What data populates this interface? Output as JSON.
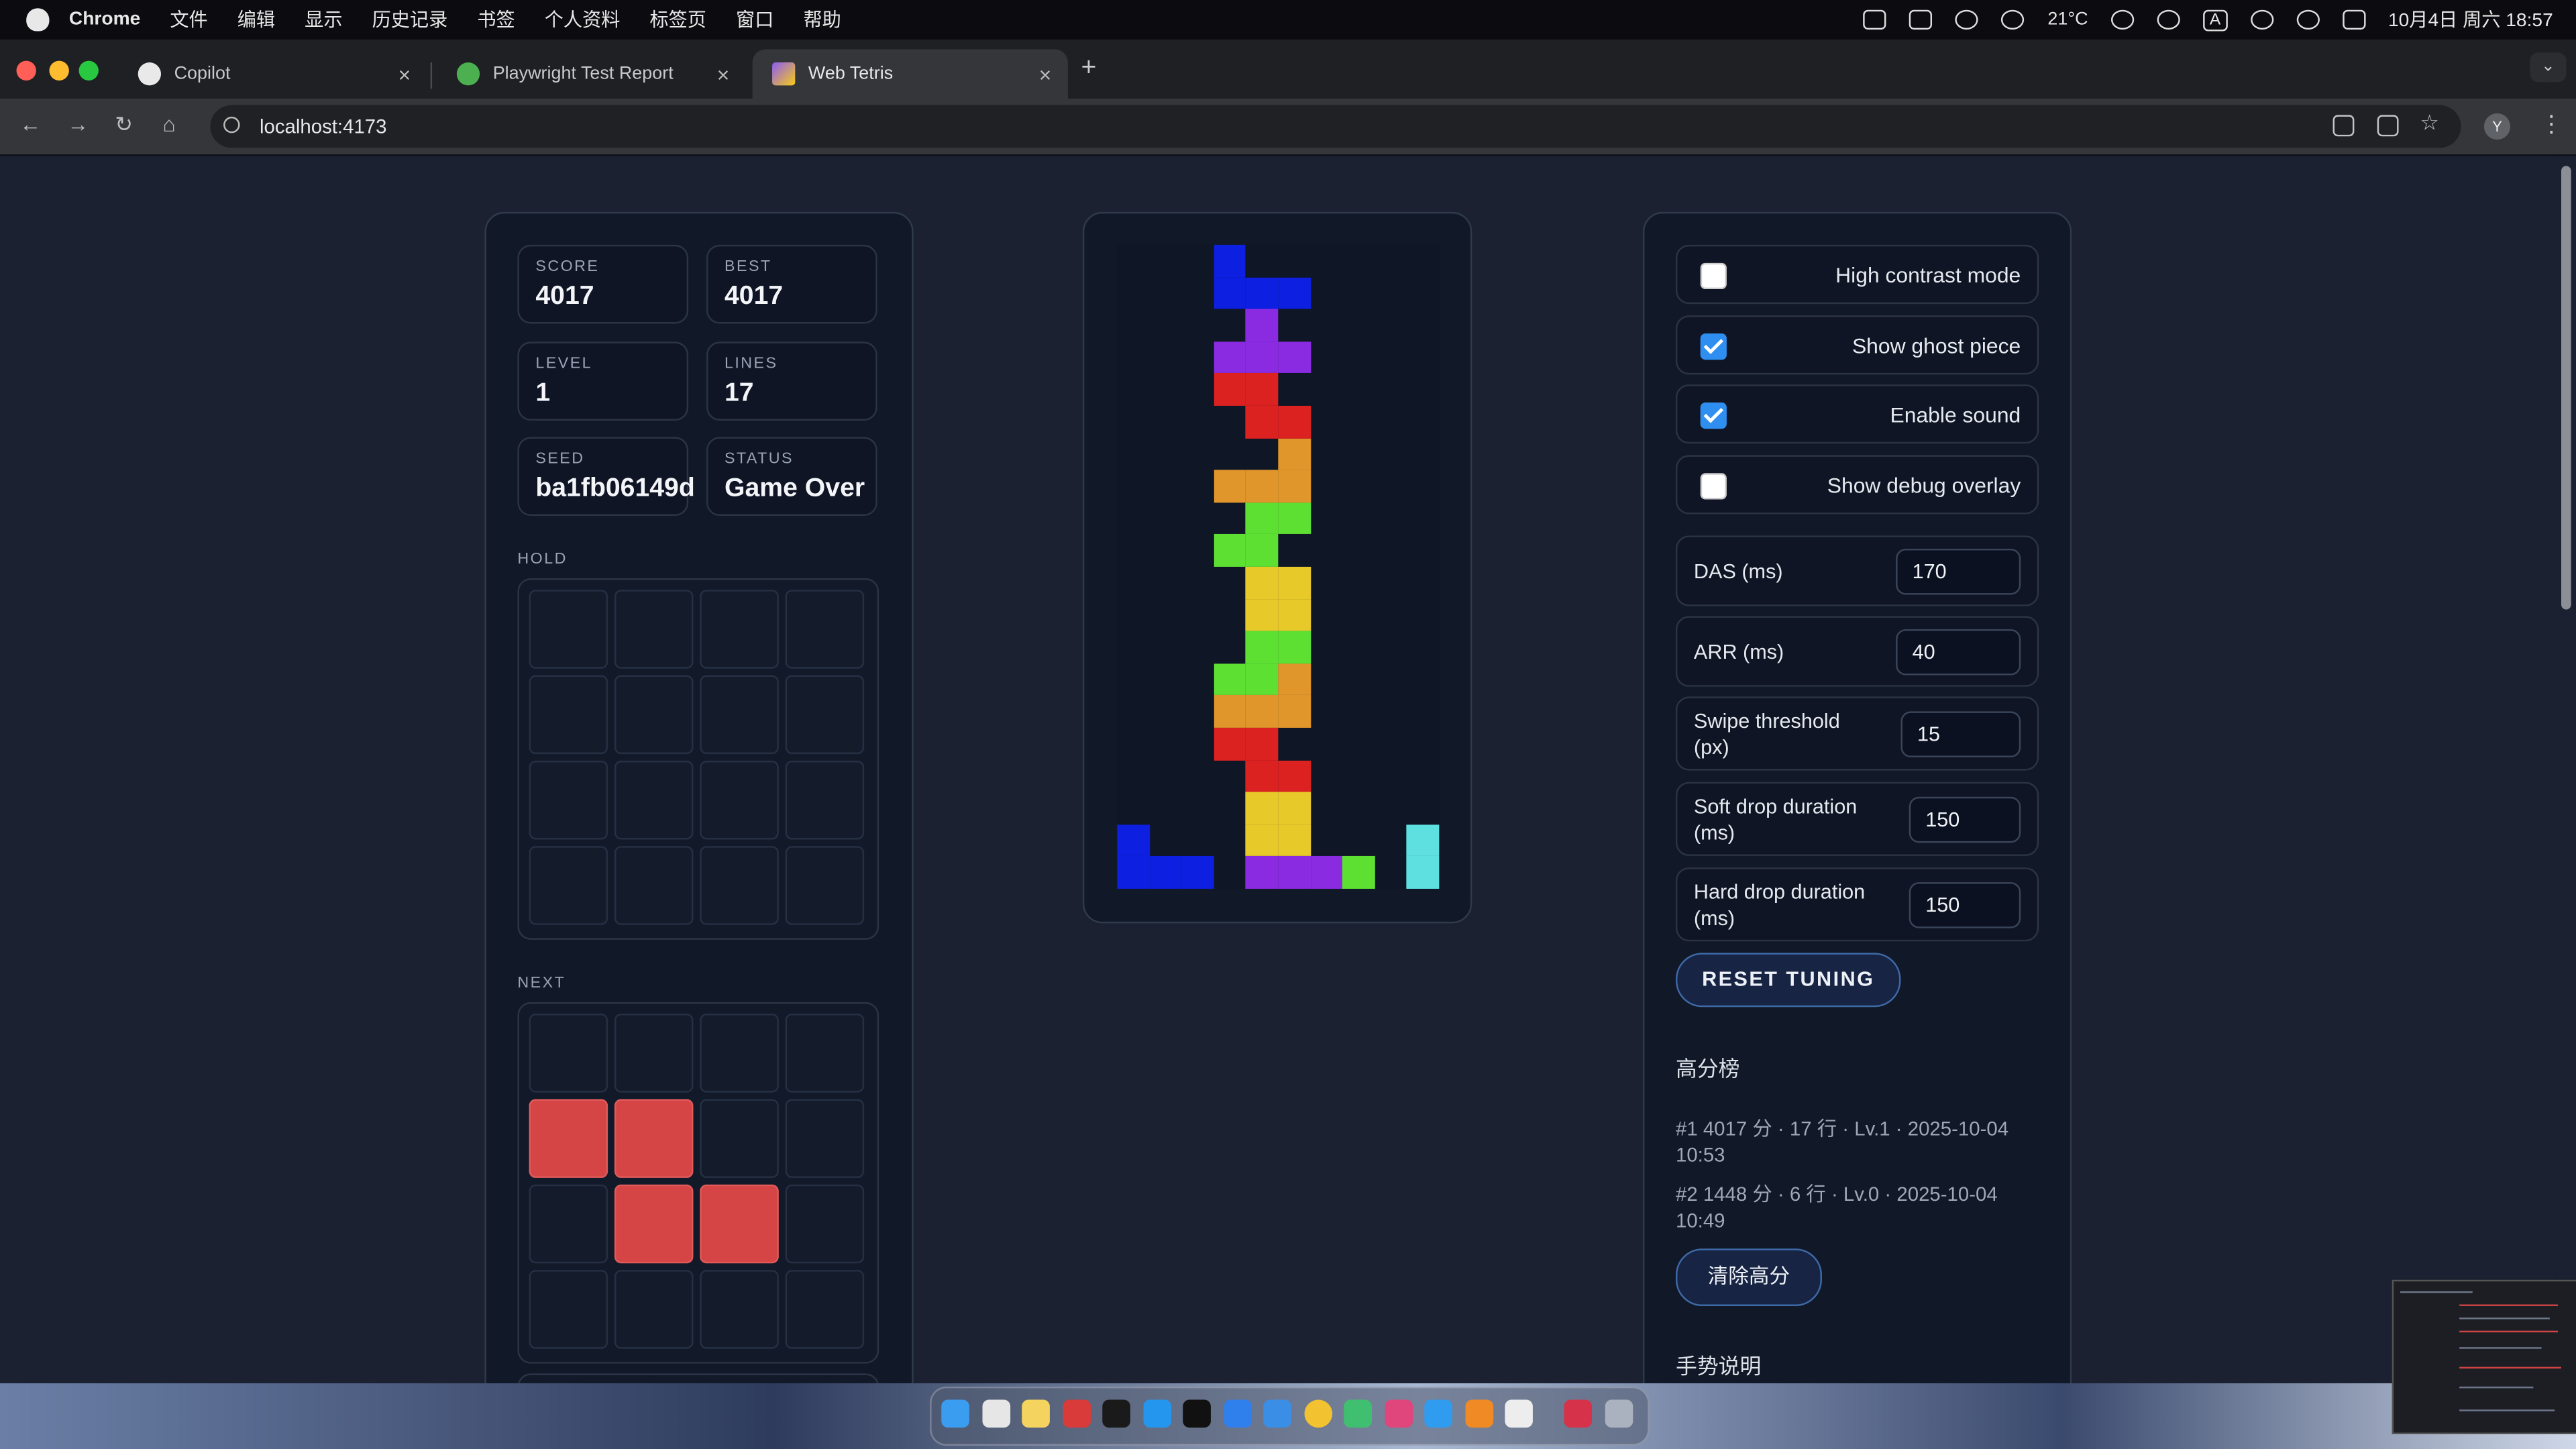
{
  "menubar": {
    "app": "Chrome",
    "items": [
      "文件",
      "编辑",
      "显示",
      "历史记录",
      "书签",
      "个人资料",
      "标签页",
      "窗口",
      "帮助"
    ],
    "weather": "21°C",
    "ime": "A",
    "clock": "10月4日 周六  18:57"
  },
  "tabs": [
    {
      "label": "Copilot",
      "icon": "github-icon"
    },
    {
      "label": "Playwright Test Report",
      "icon": "playwright-icon"
    },
    {
      "label": "Web Tetris",
      "icon": "vite-icon"
    }
  ],
  "toolbar": {
    "url": "localhost:4173",
    "avatar": "Y"
  },
  "stats": {
    "score": {
      "label": "SCORE",
      "value": "4017"
    },
    "best": {
      "label": "BEST",
      "value": "4017"
    },
    "level": {
      "label": "LEVEL",
      "value": "1"
    },
    "lines": {
      "label": "LINES",
      "value": "17"
    },
    "seed": {
      "label": "SEED",
      "value": "ba1fb06149d"
    },
    "status": {
      "label": "STATUS",
      "value": "Game Over"
    }
  },
  "hold": {
    "label": "HOLD",
    "cells": []
  },
  "next": {
    "label": "NEXT",
    "piece": "Z",
    "color": "#d64545",
    "cells": [
      [
        1,
        0
      ],
      [
        1,
        1
      ],
      [
        2,
        1
      ],
      [
        2,
        2
      ]
    ]
  },
  "board": {
    "cols": 10,
    "rows": 20,
    "colors": {
      "J": "#0d1fe0",
      "T": "#8a2be2",
      "Z": "#dc2121",
      "L": "#e0962a",
      "S": "#5ee033",
      "O": "#e8c92a",
      "I": "#5ee0e0"
    },
    "cells": [
      [
        0,
        3,
        "J"
      ],
      [
        1,
        3,
        "J"
      ],
      [
        1,
        4,
        "J"
      ],
      [
        1,
        5,
        "J"
      ],
      [
        2,
        4,
        "T"
      ],
      [
        3,
        3,
        "T"
      ],
      [
        3,
        4,
        "T"
      ],
      [
        3,
        5,
        "T"
      ],
      [
        4,
        3,
        "Z"
      ],
      [
        4,
        4,
        "Z"
      ],
      [
        5,
        4,
        "Z"
      ],
      [
        5,
        5,
        "Z"
      ],
      [
        6,
        5,
        "L"
      ],
      [
        7,
        5,
        "L"
      ],
      [
        7,
        3,
        "L"
      ],
      [
        7,
        4,
        "L"
      ],
      [
        8,
        4,
        "S"
      ],
      [
        8,
        5,
        "S"
      ],
      [
        9,
        3,
        "S"
      ],
      [
        9,
        4,
        "S"
      ],
      [
        10,
        4,
        "O"
      ],
      [
        10,
        5,
        "O"
      ],
      [
        11,
        4,
        "O"
      ],
      [
        11,
        5,
        "O"
      ],
      [
        12,
        4,
        "S"
      ],
      [
        12,
        5,
        "S"
      ],
      [
        13,
        3,
        "S"
      ],
      [
        13,
        4,
        "S"
      ],
      [
        13,
        5,
        "L"
      ],
      [
        14,
        3,
        "L"
      ],
      [
        14,
        4,
        "L"
      ],
      [
        14,
        5,
        "L"
      ],
      [
        15,
        3,
        "Z"
      ],
      [
        15,
        4,
        "Z"
      ],
      [
        16,
        4,
        "Z"
      ],
      [
        16,
        5,
        "Z"
      ],
      [
        17,
        4,
        "O"
      ],
      [
        17,
        5,
        "O"
      ],
      [
        18,
        4,
        "O"
      ],
      [
        18,
        5,
        "O"
      ],
      [
        19,
        4,
        "T"
      ],
      [
        19,
        5,
        "T"
      ],
      [
        19,
        6,
        "T"
      ],
      [
        19,
        7,
        "S"
      ],
      [
        18,
        0,
        "J"
      ],
      [
        19,
        0,
        "J"
      ],
      [
        19,
        1,
        "J"
      ],
      [
        19,
        2,
        "J"
      ],
      [
        18,
        9,
        "I"
      ],
      [
        19,
        9,
        "I"
      ]
    ]
  },
  "settings": {
    "options": [
      {
        "label": "High contrast mode",
        "checked": false
      },
      {
        "label": "Show ghost piece",
        "checked": true
      },
      {
        "label": "Enable sound",
        "checked": true
      },
      {
        "label": "Show debug overlay",
        "checked": false
      }
    ],
    "tuning": [
      {
        "label": "DAS (ms)",
        "value": "170"
      },
      {
        "label": "ARR (ms)",
        "value": "40"
      },
      {
        "label": "Swipe threshold (px)",
        "value": "15"
      },
      {
        "label": "Soft drop duration (ms)",
        "value": "150"
      },
      {
        "label": "Hard drop duration (ms)",
        "value": "150"
      }
    ],
    "reset_label": "RESET TUNING"
  },
  "highscores": {
    "title": "高分榜",
    "entries": [
      "#1 4017 分 · 17 行 · Lv.1 · 2025-10-04 10:53",
      "#2 1448 分 · 6 行 · Lv.0 · 2025-10-04 10:49"
    ],
    "clear_label": "清除高分"
  },
  "gestures": {
    "title": "手势说明"
  },
  "theme": {
    "checkbox_on": "#2e8ff0",
    "panel_bg": "#111827",
    "page_bg": "#1b2130"
  }
}
